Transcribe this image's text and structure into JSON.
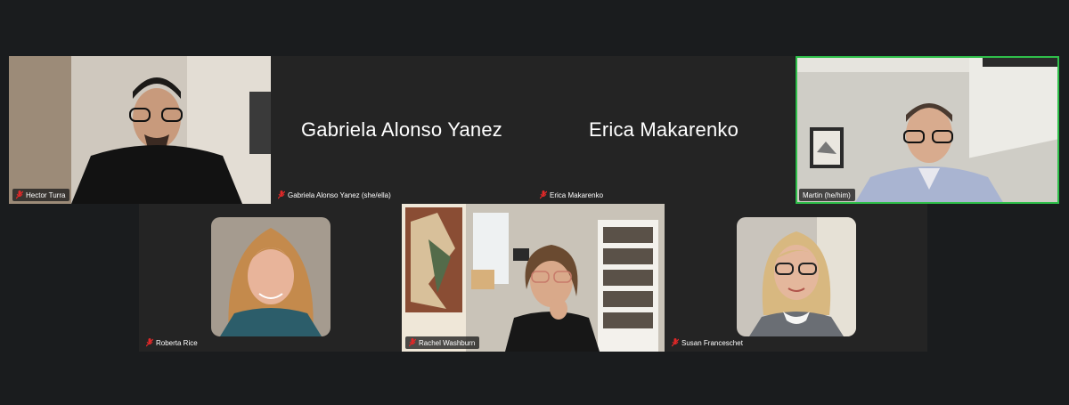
{
  "participants": {
    "hector": {
      "label": "Hector Turra"
    },
    "gabriela": {
      "label": "Gabriela Alonso Yanez (she/ella)",
      "display_name": "Gabriela Alonso Yanez"
    },
    "erica": {
      "label": "Erica Makarenko",
      "display_name": "Erica Makarenko"
    },
    "martin": {
      "label": "Martin (he/him)"
    },
    "roberta": {
      "label": "Roberta Rice"
    },
    "rachel": {
      "label": "Rachel Washburn"
    },
    "susan": {
      "label": "Susan Franceschet"
    }
  },
  "colors": {
    "background": "#1a1c1e",
    "tile": "#242424",
    "active_speaker_border": "#2fbf4a",
    "muted_icon": "#e02828"
  },
  "icons": {
    "muted": "muted-mic-icon"
  }
}
